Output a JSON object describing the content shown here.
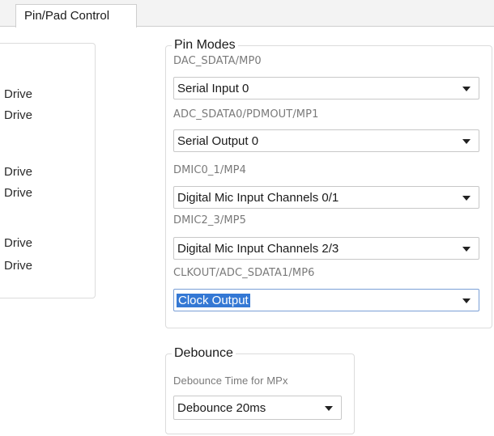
{
  "tabs": [
    {
      "label": "Pin/Pad Control",
      "active": true
    }
  ],
  "left_panel": {
    "drive_labels": [
      "Drive",
      "Drive",
      "Drive",
      "Drive",
      "Drive",
      "Drive"
    ]
  },
  "pin_modes": {
    "title": "Pin Modes",
    "fields": [
      {
        "label": "DAC_SDATA/MP0",
        "value": "Serial Input 0"
      },
      {
        "label": "ADC_SDATA0/PDMOUT/MP1",
        "value": "Serial Output 0"
      },
      {
        "label": "DMIC0_1/MP4",
        "value": "Digital Mic Input Channels 0/1"
      },
      {
        "label": "DMIC2_3/MP5",
        "value": "Digital Mic Input Channels 2/3"
      },
      {
        "label": "CLKOUT/ADC_SDATA1/MP6",
        "value": "Clock Output"
      }
    ]
  },
  "debounce": {
    "title": "Debounce",
    "label": "Debounce Time for MPx",
    "value": "Debounce 20ms"
  },
  "colors": {
    "selection": "#3478d4",
    "border": "#dcdcdc",
    "tabstrip": "#f3f3f3"
  },
  "icons": {
    "dropdown": "chevron-down-icon"
  }
}
